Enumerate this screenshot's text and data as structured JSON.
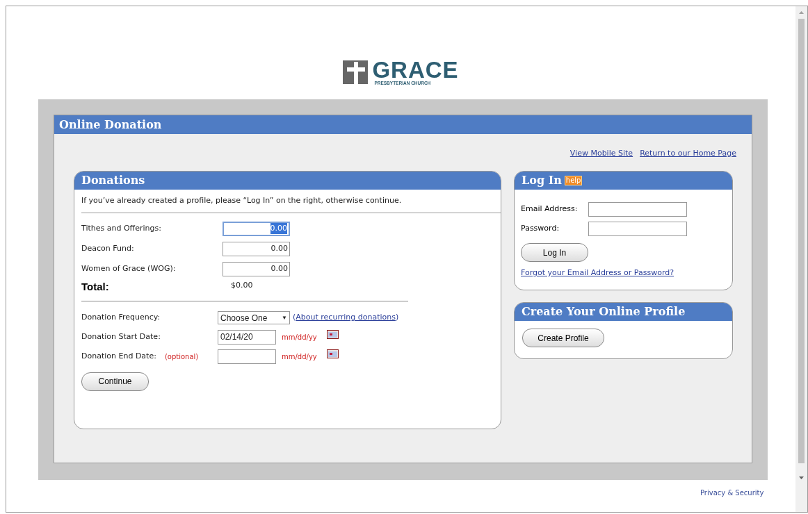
{
  "logo": {
    "name": "GRACE",
    "subtitle": "PRESBYTERIAN CHURCH"
  },
  "panel": {
    "title": "Online Donation"
  },
  "top_links": [
    "View Mobile Site",
    "Return to our Home Page"
  ],
  "donations": {
    "title": "Donations",
    "intro": "If you’ve already created a profile, please “Log In” on the right, otherwise continue.",
    "funds": [
      {
        "label": "Tithes and Offerings:",
        "value": "0.00",
        "focused": true
      },
      {
        "label": "Deacon Fund:",
        "value": "0.00",
        "focused": false
      },
      {
        "label": "Women of Grace (WOG):",
        "value": "0.00",
        "focused": false
      }
    ],
    "total": {
      "label": "Total:",
      "value": "$0.00"
    },
    "frequency": {
      "label": "Donation Frequency:",
      "value": "Choose One",
      "arrow": "▼",
      "link_open": "(",
      "link": "About recurring donations",
      "link_close": ")"
    },
    "start_date": {
      "label": "Donation Start Date:",
      "value": "02/14/20",
      "format": "mm/dd/yy"
    },
    "end_date": {
      "label": "Donation End Date:",
      "note": "(optional)",
      "format": "mm/dd/yy"
    },
    "button": "Continue"
  },
  "login": {
    "title": "Log In",
    "help": "help",
    "email_label": "Email Address:",
    "password_label": "Password:",
    "button": "Log In",
    "forgot": "Forgot your Email Address or Password?"
  },
  "create": {
    "title": "Create Your Online Profile",
    "button": "Create Profile"
  },
  "footer_link": "Privacy & Security"
}
